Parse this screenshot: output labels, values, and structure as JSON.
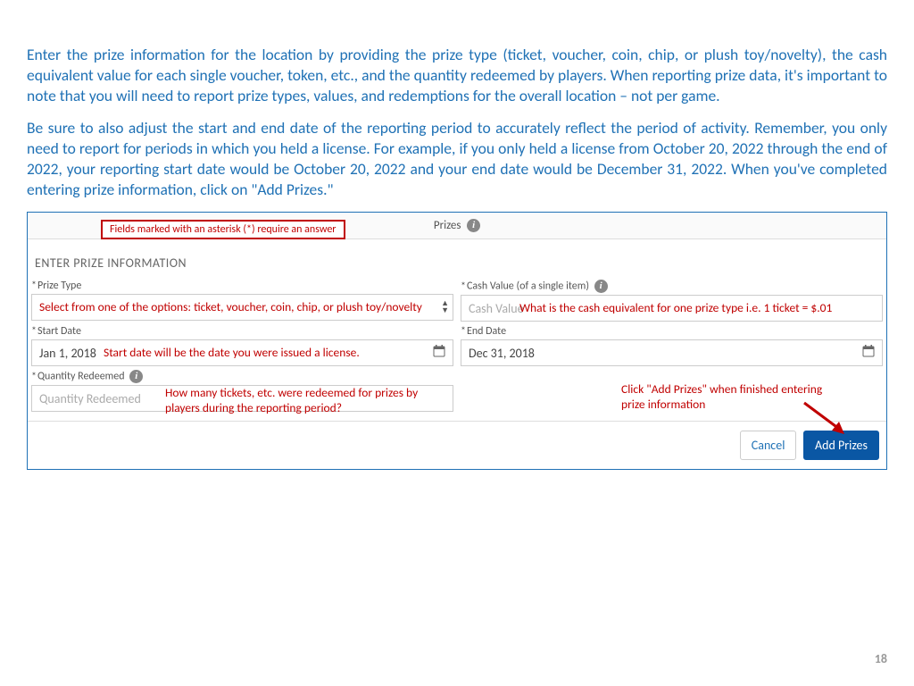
{
  "intro": {
    "p1": "Enter the prize information for the location by providing the prize type (ticket, voucher, coin, chip, or plush toy/novelty), the cash equivalent value for each single voucher, token, etc., and the quantity redeemed by players. When reporting prize data, it's important to note that you will need to report prize types, values, and redemptions for the overall location – not per game.",
    "p2": "Be sure to also adjust the start and end date of the reporting period to accurately reflect the period of activity.  Remember, you only need to report for periods in which you held a license.  For example, if you only held a license from October 20, 2022 through the end of 2022, your reporting start date would be October 20, 2022 and your end date would be December 31, 2022.  When you've completed entering prize information, click on \"Add Prizes.\""
  },
  "form": {
    "header_label": "Prizes",
    "required_note": "Fields marked with an asterisk (*) require an answer",
    "section_heading": "ENTER PRIZE INFORMATION",
    "prize_type": {
      "label": "Prize Type"
    },
    "cash_value": {
      "label": "Cash Value (of a single item)",
      "placeholder": "Cash Value"
    },
    "start_date": {
      "label": "Start Date",
      "value": "Jan 1, 2018"
    },
    "end_date": {
      "label": "End Date",
      "value": "Dec 31, 2018"
    },
    "qty": {
      "label": "Quantity Redeemed",
      "placeholder": "Quantity Redeemed"
    },
    "buttons": {
      "cancel": "Cancel",
      "add": "Add Prizes"
    }
  },
  "annotations": {
    "prize_type": "Select from one of the options: ticket, voucher, coin, chip, or plush toy/novelty",
    "cash_value": "What is the cash equivalent for one prize type i.e. 1 ticket = $.01",
    "start_date": "Start date will be the date you were issued a license.",
    "qty": "How many tickets, etc. were redeemed for prizes by players during the reporting period?",
    "add_prizes": "Click \"Add Prizes\" when finished entering prize information"
  },
  "page_number": "18"
}
